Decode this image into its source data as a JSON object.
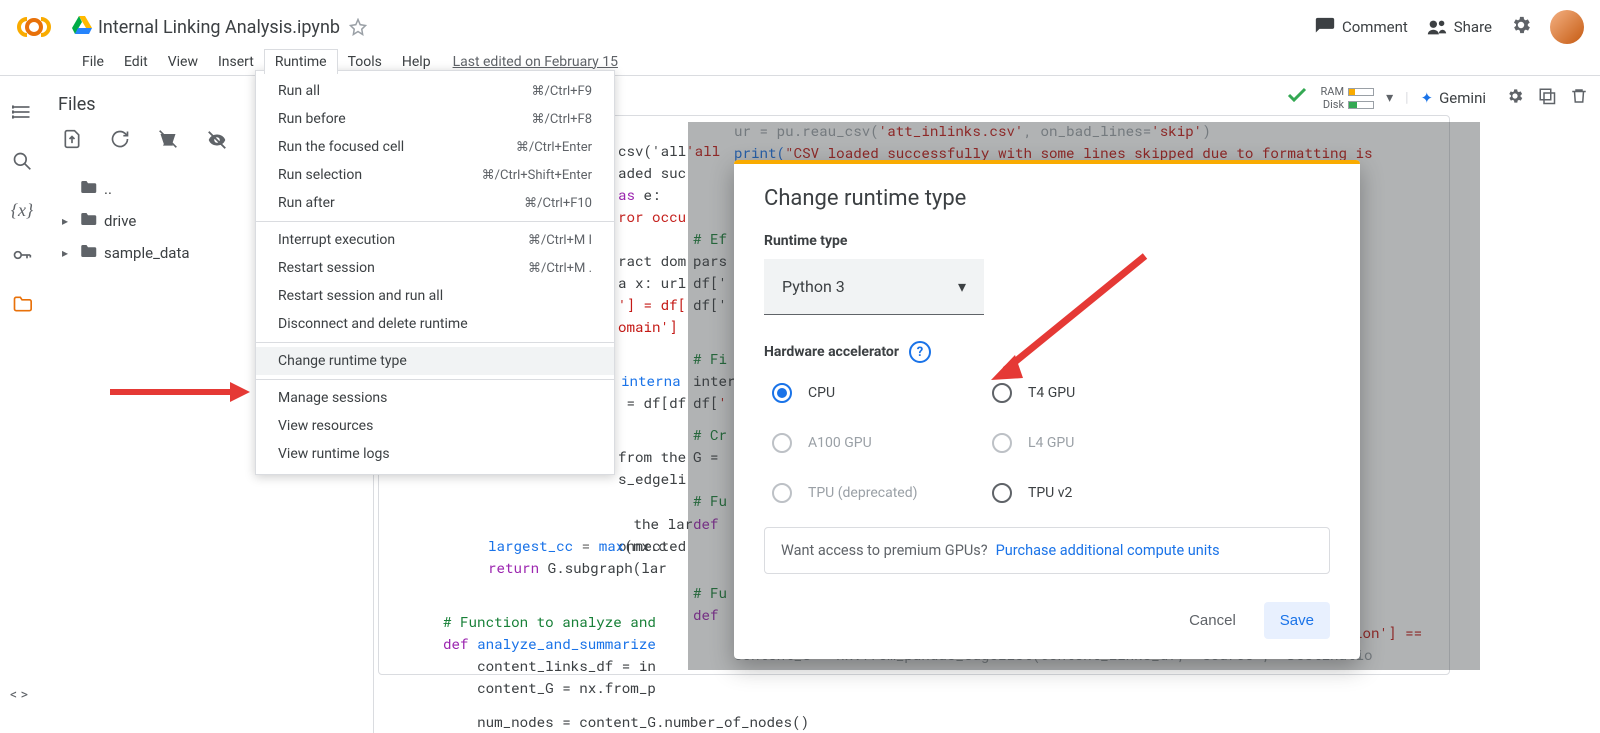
{
  "header": {
    "doc_title": "Internal Linking Analysis.ipynb",
    "comment": "Comment",
    "share": "Share"
  },
  "menubar": {
    "items": [
      "File",
      "Edit",
      "View",
      "Insert",
      "Runtime",
      "Tools",
      "Help"
    ],
    "last_edited": "Last edited on February 15"
  },
  "status": {
    "ram_label": "RAM",
    "disk_label": "Disk",
    "gemini": "Gemini"
  },
  "files_panel": {
    "title": "Files",
    "entries": [
      {
        "name": "..",
        "expandable": false
      },
      {
        "name": "drive",
        "expandable": true
      },
      {
        "name": "sample_data",
        "expandable": true
      }
    ]
  },
  "runtime_menu": [
    {
      "label": "Run all",
      "shortcut": "⌘/Ctrl+F9"
    },
    {
      "label": "Run before",
      "shortcut": "⌘/Ctrl+F8"
    },
    {
      "label": "Run the focused cell",
      "shortcut": "⌘/Ctrl+Enter"
    },
    {
      "label": "Run selection",
      "shortcut": "⌘/Ctrl+Shift+Enter"
    },
    {
      "label": "Run after",
      "shortcut": "⌘/Ctrl+F10"
    },
    {
      "sep": true
    },
    {
      "label": "Interrupt execution",
      "shortcut": "⌘/Ctrl+M I"
    },
    {
      "label": "Restart session",
      "shortcut": "⌘/Ctrl+M ."
    },
    {
      "label": "Restart session and run all",
      "shortcut": ""
    },
    {
      "label": "Disconnect and delete runtime",
      "shortcut": ""
    },
    {
      "sep": true
    },
    {
      "label": "Change runtime type",
      "shortcut": "",
      "highlight": true
    },
    {
      "sep": true
    },
    {
      "label": "Manage sessions",
      "shortcut": ""
    },
    {
      "label": "View resources",
      "shortcut": ""
    },
    {
      "label": "View runtime logs",
      "shortcut": ""
    }
  ],
  "modal": {
    "title": "Change runtime type",
    "runtime_type_label": "Runtime type",
    "runtime_type_value": "Python 3",
    "hw_label": "Hardware accelerator",
    "radios": [
      {
        "label": "CPU",
        "selected": true,
        "disabled": false
      },
      {
        "label": "T4 GPU",
        "selected": false,
        "disabled": false
      },
      {
        "label": "A100 GPU",
        "selected": false,
        "disabled": true
      },
      {
        "label": "L4 GPU",
        "selected": false,
        "disabled": true
      },
      {
        "label": "TPU (deprecated)",
        "selected": false,
        "disabled": true
      },
      {
        "label": "TPU v2",
        "selected": false,
        "disabled": false
      }
    ],
    "premium_text": "Want access to premium GPUs?",
    "premium_link": "Purchase additional compute units",
    "cancel": "Cancel",
    "save": "Save"
  },
  "code": {
    "l0": "csv('all",
    "l1": "aded suc",
    "l2": "as e:",
    "l3": "ror occu",
    "l4a": "# Ef",
    "l4b": "ract dom",
    "l5": "pars",
    "l6": "a x: url",
    "l7a": "'] = df[",
    "l7b": "omain']",
    "l8": "# Fi",
    "l9a": "interna",
    "l9b": " = df[df",
    "l10": "# Cr",
    "l11a": "from the",
    "l11b": "s_edgeli",
    "l12": "# Fu",
    "l13a": " the lar",
    "l13b": "onnected",
    "l14": "    largest_cc = max(nx.c",
    "l15": "    return G.subgraph(lar",
    "l16": "# Function to analyze and",
    "l17": "def analyze_and_summarize",
    "l18": "    content_links_df = in",
    "l19": "    content_G = nx.from_p",
    "l20": "    num_nodes = content_G.number_of_nodes()",
    "r0a": "ur = pu.reau_csv(",
    "r0b": "'att_inlinks.csv'",
    "r0c": ", on_bad_lines=",
    "r0d": "'skip'",
    "r0e": ")",
    "r1a": "print(",
    "r1b": "\"CSV loaded successfully with some lines skipped due to formatting is",
    "r17": "content_G = nx.from_pandas_edgelist(content_links_df, 'Source', 'Destinatio",
    "inter": "interna",
    "df1a": "df[",
    "df1b": "'",
    "g_eq": "G =",
    "def_kw": "def",
    "fu_cmt": "# Fu",
    "ion_str": "ion'] =="
  }
}
